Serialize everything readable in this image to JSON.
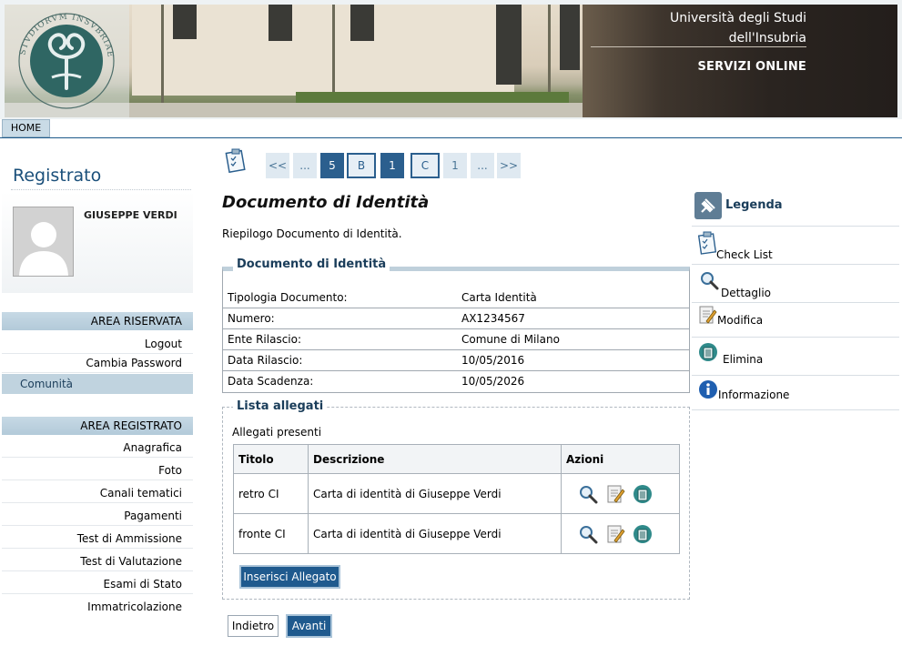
{
  "header": {
    "uni_line1": "Università degli Studi",
    "uni_line2": "dell'Insubria",
    "services": "SERVIZI ONLINE"
  },
  "nav": {
    "home": "HOME"
  },
  "sidebar": {
    "title": "Registrato",
    "user_name": "GIUSEPPE VERDI",
    "area_riservata": {
      "heading": "AREA RISERVATA",
      "items": [
        "Logout",
        "Cambia Password"
      ]
    },
    "active_item": "Comunità",
    "area_registrato": {
      "heading": "AREA REGISTRATO",
      "items": [
        "Anagrafica",
        "Foto",
        "Canali tematici",
        "Pagamenti",
        "Test di Ammissione",
        "Test di Valutazione",
        "Esami di Stato",
        "Immatricolazione"
      ]
    }
  },
  "pager": {
    "items": [
      "<<",
      "...",
      "5",
      "B",
      "1",
      "C",
      "1",
      "...",
      ">>"
    ]
  },
  "main": {
    "title": "Documento di Identità",
    "description": "Riepilogo Documento di Identità.",
    "doc_section_title": "Documento di Identità",
    "doc_rows": [
      {
        "label": "Tipologia Documento:",
        "value": "Carta Identità"
      },
      {
        "label": "Numero:",
        "value": "AX1234567"
      },
      {
        "label": "Ente Rilascio:",
        "value": "Comune di Milano"
      },
      {
        "label": "Data Rilascio:",
        "value": "10/05/2016"
      },
      {
        "label": "Data Scadenza:",
        "value": "10/05/2026"
      }
    ],
    "att_section_title": "Lista allegati",
    "att_present": "Allegati presenti",
    "att_headers": {
      "title": "Titolo",
      "desc": "Descrizione",
      "actions": "Azioni"
    },
    "att_rows": [
      {
        "title": "retro CI",
        "desc": "Carta di identità di Giuseppe Verdi"
      },
      {
        "title": "fronte CI",
        "desc": "Carta di identità di Giuseppe Verdi"
      }
    ],
    "insert_button": "Inserisci Allegato",
    "back_button": "Indietro",
    "next_button": "Avanti"
  },
  "legend": {
    "title": "Legenda",
    "items": [
      "Check List",
      "Dettaglio",
      "Modifica",
      "Elimina",
      "Informazione"
    ]
  }
}
